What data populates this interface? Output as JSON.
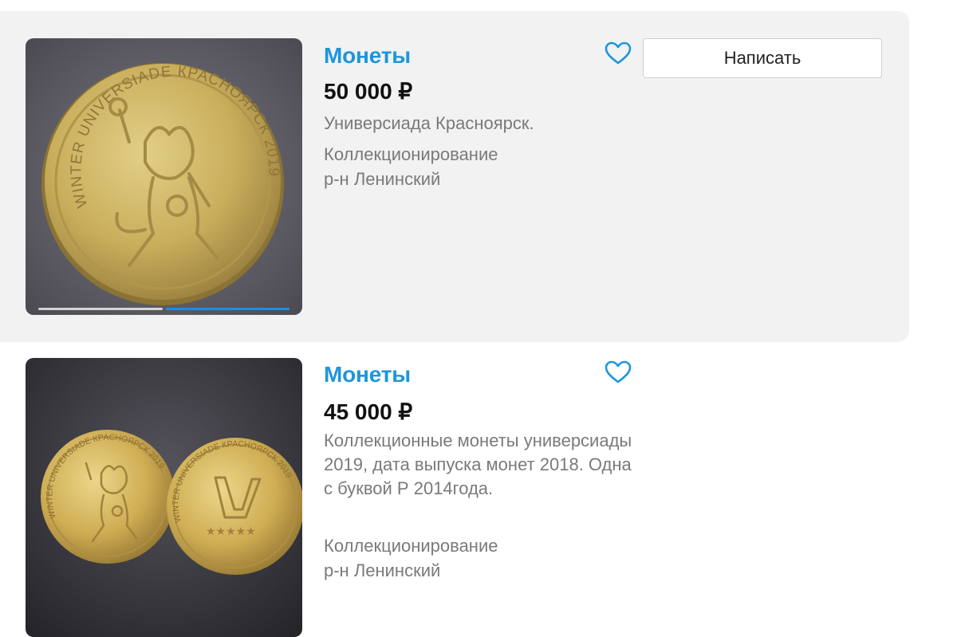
{
  "listings": [
    {
      "title": "Монеты",
      "price": "50 000 ₽",
      "description": "Универсиада Красноярск.",
      "category": "Коллекционирование",
      "district": "р-н Ленинский",
      "write_label": "Написать",
      "favorite_icon": "heart-outline-icon",
      "photo": {
        "coin_inscription": "WINTER UNIVERSIADE КРАСНОЯРСК 2019",
        "gallery_count": 2,
        "gallery_active": 2
      }
    },
    {
      "title": "Монеты",
      "price": "45 000 ₽",
      "description": "Коллекционные монеты универсиады 2019, дата выпуска монет 2018. Одна с буквой Р 2014года.",
      "category": "Коллекционирование",
      "district": "р-н Ленинский",
      "favorite_icon": "heart-outline-icon",
      "photo": {
        "coin_inscription": "WINTER UNIVERSIADE КРАСНОЯРСК 2019"
      }
    }
  ],
  "colors": {
    "accent": "#1e96dc",
    "card_hover_bg": "#f2f2f2",
    "muted_text": "#7a7a7a",
    "coin_gold": "#c9ae5c"
  }
}
